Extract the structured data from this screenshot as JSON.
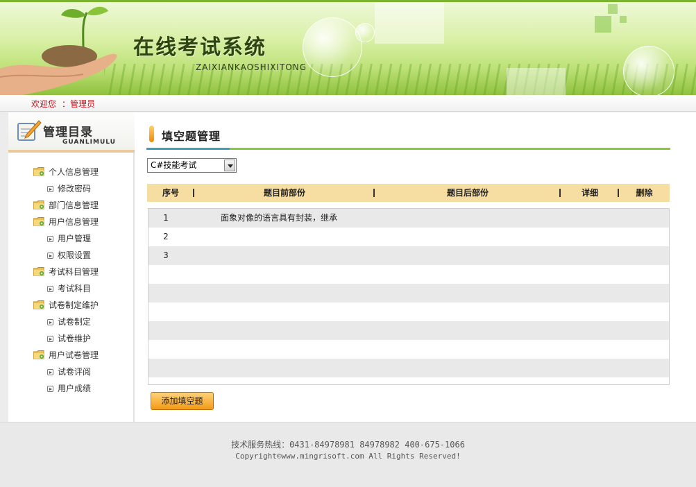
{
  "banner": {
    "title": "在线考试系统",
    "subtitle": "ZAIXIANKAOSHIXITONG"
  },
  "welcome": {
    "greeting": "欢迎您",
    "user": "：管理员"
  },
  "sidebar": {
    "title": "管理目录",
    "subtitle": "GUANLIMULU",
    "items": [
      {
        "type": "cat",
        "label": "个人信息管理",
        "icon": "folder-icon"
      },
      {
        "type": "sub",
        "label": "修改密码",
        "icon": "arrow-bullet-icon"
      },
      {
        "type": "cat",
        "label": "部门信息管理",
        "icon": "folder-icon"
      },
      {
        "type": "cat",
        "label": "用户信息管理",
        "icon": "folder-icon"
      },
      {
        "type": "sub",
        "label": "用户管理",
        "icon": "arrow-bullet-icon"
      },
      {
        "type": "sub",
        "label": "权限设置",
        "icon": "arrow-bullet-icon"
      },
      {
        "type": "cat",
        "label": "考试科目管理",
        "icon": "folder-icon"
      },
      {
        "type": "sub",
        "label": "考试科目",
        "icon": "arrow-bullet-icon"
      },
      {
        "type": "cat",
        "label": "试卷制定维护",
        "icon": "folder-icon"
      },
      {
        "type": "sub",
        "label": "试卷制定",
        "icon": "arrow-bullet-icon"
      },
      {
        "type": "sub",
        "label": "试卷维护",
        "icon": "arrow-bullet-icon"
      },
      {
        "type": "cat",
        "label": "用户试卷管理",
        "icon": "folder-icon"
      },
      {
        "type": "sub",
        "label": "试卷评阅",
        "icon": "arrow-bullet-icon"
      },
      {
        "type": "sub",
        "label": "用户成绩",
        "icon": "arrow-bullet-icon"
      }
    ]
  },
  "content": {
    "title": "填空题管理",
    "exam_select": {
      "selected": "C#技能考试"
    },
    "table": {
      "columns": [
        "序号",
        "题目前部份",
        "题目后部份",
        "详细",
        "删除"
      ],
      "rows": [
        {
          "no": "1",
          "front": "面象对像的语言具有封装，继承"
        },
        {
          "no": "2",
          "front": ""
        },
        {
          "no": "3",
          "front": ""
        },
        {
          "no": "",
          "front": ""
        },
        {
          "no": "",
          "front": ""
        },
        {
          "no": "",
          "front": ""
        },
        {
          "no": "",
          "front": ""
        },
        {
          "no": "",
          "front": ""
        },
        {
          "no": "",
          "front": ""
        }
      ]
    },
    "add_button": "添加填空题"
  },
  "footer": {
    "hotline": "技术服务热线：0431-84978981  84978982 400-675-1066",
    "copyright": "Copyright©www.mingrisoft.com All Rights Reserved!"
  },
  "colors": {
    "banner_green": "#8fc13e",
    "welcome_red": "#c8101a",
    "table_header": "#f6dda2",
    "button_orange": "#f39b16",
    "title_underline": "#8cc63f"
  }
}
